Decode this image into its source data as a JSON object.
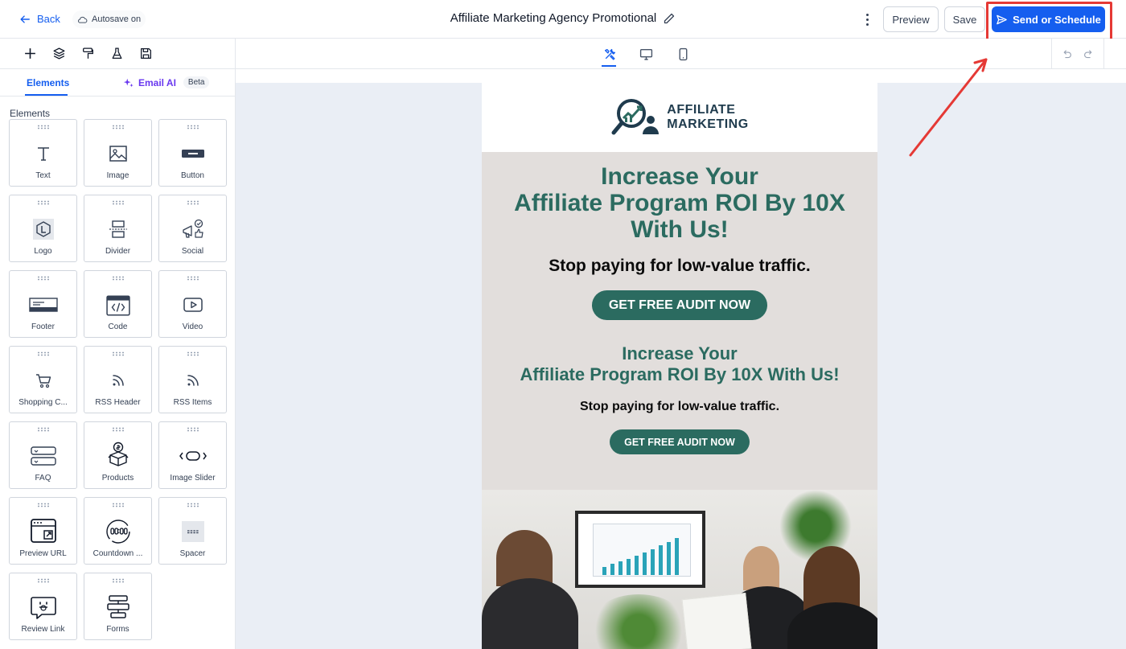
{
  "topbar": {
    "back_label": "Back",
    "autosave_label": "Autosave on",
    "title": "Affiliate Marketing Agency Promotional",
    "preview_label": "Preview",
    "save_label": "Save",
    "send_label": "Send or Schedule"
  },
  "sidebar": {
    "tab_elements": "Elements",
    "tab_ai": "Email AI",
    "beta_label": "Beta",
    "section_label": "Elements",
    "elements": [
      {
        "label": "Text",
        "icon": "text-icon"
      },
      {
        "label": "Image",
        "icon": "image-icon"
      },
      {
        "label": "Button",
        "icon": "button-icon"
      },
      {
        "label": "Logo",
        "icon": "logo-icon"
      },
      {
        "label": "Divider",
        "icon": "divider-icon"
      },
      {
        "label": "Social",
        "icon": "social-icon"
      },
      {
        "label": "Footer",
        "icon": "footer-icon"
      },
      {
        "label": "Code",
        "icon": "code-icon"
      },
      {
        "label": "Video",
        "icon": "video-icon"
      },
      {
        "label": "Shopping C...",
        "icon": "cart-icon"
      },
      {
        "label": "RSS Header",
        "icon": "rss-icon"
      },
      {
        "label": "RSS Items",
        "icon": "rss-icon"
      },
      {
        "label": "FAQ",
        "icon": "faq-icon"
      },
      {
        "label": "Products",
        "icon": "products-icon"
      },
      {
        "label": "Image Slider",
        "icon": "slider-icon"
      },
      {
        "label": "Preview URL",
        "icon": "preview-url-icon"
      },
      {
        "label": "Countdown ...",
        "icon": "countdown-icon"
      },
      {
        "label": "Spacer",
        "icon": "spacer-icon"
      },
      {
        "label": "Review Link",
        "icon": "review-link-icon"
      },
      {
        "label": "Forms",
        "icon": "forms-icon"
      }
    ]
  },
  "email": {
    "logo_line1": "AFFILIATE",
    "logo_line2": "MARKETING",
    "heading1_line1": "Increase Your",
    "heading1_line2": "Affiliate Program ROI By 10X",
    "heading1_line3": "With Us!",
    "subheading1": "Stop paying for low-value traffic.",
    "cta1": "GET FREE AUDIT NOW",
    "heading2_line1": "Increase Your",
    "heading2_line2": "Affiliate Program ROI By 10X With Us!",
    "subheading2": "Stop paying for low-value traffic.",
    "cta2": "GET FREE AUDIT NOW"
  },
  "colors": {
    "primary": "#155eef",
    "brand_green": "#2b6b60",
    "highlight_red": "#e53935",
    "ai_purple": "#6938ef"
  }
}
